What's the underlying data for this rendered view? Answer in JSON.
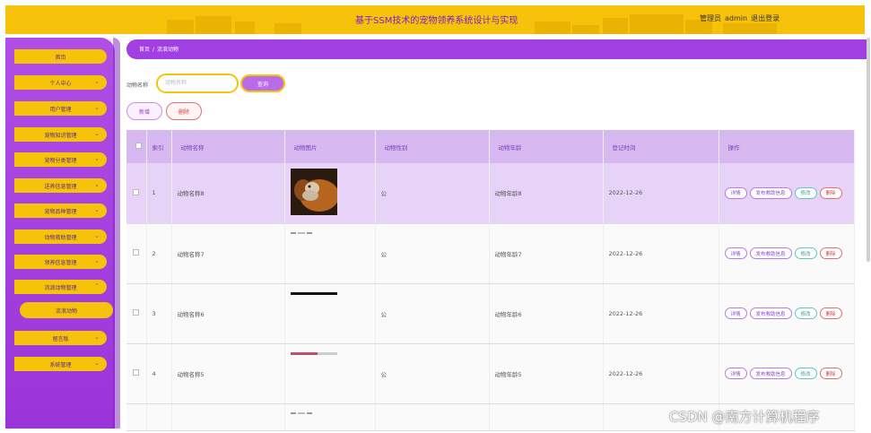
{
  "header": {
    "title": "基于SSM技术的宠物领养系统设计与实现",
    "role_label": "管理员",
    "username": "admin",
    "logout_label": "退出登录",
    "banner_color": "#f7c20a",
    "title_color": "#7a1fd0"
  },
  "sidebar": {
    "color": "#a13fe2",
    "items": [
      {
        "label": "首页"
      },
      {
        "label": "个人中心"
      },
      {
        "label": "用户管理"
      },
      {
        "label": "宠物知识管理"
      },
      {
        "label": "宠物分类管理"
      },
      {
        "label": "送养信息管理"
      },
      {
        "label": "宠物品种管理"
      },
      {
        "label": "动物救助管理"
      },
      {
        "label": "领养信息管理"
      },
      {
        "label": "流浪动物管理"
      },
      {
        "label": "留言板"
      },
      {
        "label": "系统管理"
      }
    ],
    "sub_item": {
      "label": "流浪动物"
    }
  },
  "breadcrumb": {
    "home": "首页",
    "separator": "/",
    "current": "流浪动物"
  },
  "search": {
    "label": "动物名称",
    "placeholder": "动物名称",
    "button": "查询"
  },
  "actions": {
    "add": "新增",
    "delete": "删除"
  },
  "table": {
    "headers": [
      "索引",
      "动物名称",
      "动物图片",
      "动物性别",
      "动物年龄",
      "登记时间",
      "操作"
    ],
    "rows": [
      {
        "index": "1",
        "name": "动物名称8",
        "gender": "公",
        "age": "动物年龄8",
        "date": "2022-12-26"
      },
      {
        "index": "2",
        "name": "动物名称7",
        "gender": "公",
        "age": "动物年龄7",
        "date": "2022-12-26"
      },
      {
        "index": "3",
        "name": "动物名称6",
        "gender": "公",
        "age": "动物年龄6",
        "date": "2022-12-26"
      },
      {
        "index": "4",
        "name": "动物名称5",
        "gender": "公",
        "age": "动物年龄5",
        "date": "2022-12-26"
      }
    ],
    "row_ops": {
      "detail": "详情",
      "publish": "发布救助信息",
      "edit": "修改",
      "delete": "删除"
    }
  },
  "watermark": "CSDN @南方计算机程序"
}
